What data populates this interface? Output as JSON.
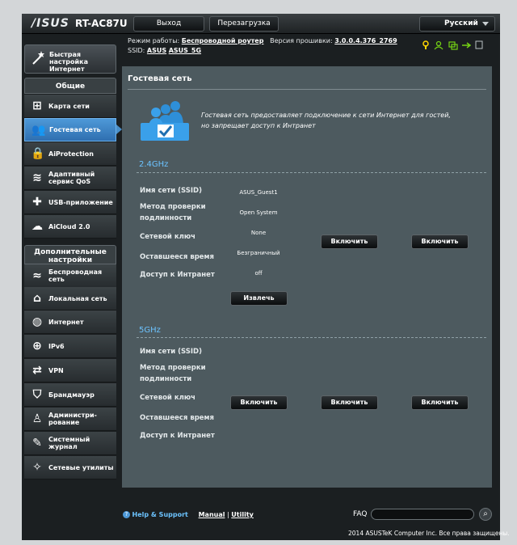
{
  "header": {
    "logo": "/ISUS",
    "model": "RT-AC87U",
    "logout": "Выход",
    "reboot": "Перезагрузка",
    "language": "Русский"
  },
  "info": {
    "mode_label": "Режим работы:",
    "mode_value": "Беспроводной роутер",
    "fw_label": "Версия прошивки:",
    "fw_value": "3.0.0.4.376_2769",
    "ssid_label": "SSID:",
    "ssid1": "ASUS",
    "ssid2": "ASUS_5G"
  },
  "sidebar": {
    "quick": "Быстрая настройка Интернет",
    "general_title": "Общие",
    "general": [
      {
        "label": "Карта сети",
        "icon": "network-map-icon"
      },
      {
        "label": "Гостевая сеть",
        "icon": "guest-network-icon"
      },
      {
        "label": "AiProtection",
        "icon": "lock-icon"
      },
      {
        "label": "Адаптивный сервис QoS",
        "icon": "qos-icon"
      },
      {
        "label": "USB-приложение",
        "icon": "usb-app-icon"
      },
      {
        "label": "AiCloud 2.0",
        "icon": "cloud-icon"
      }
    ],
    "advanced_title": "Дополнительные настройки",
    "advanced": [
      {
        "label": "Беспроводная сеть",
        "icon": "wifi-icon"
      },
      {
        "label": "Локальная сеть",
        "icon": "home-icon"
      },
      {
        "label": "Интернет",
        "icon": "globe-icon"
      },
      {
        "label": "IPv6",
        "icon": "ipv6-icon"
      },
      {
        "label": "VPN",
        "icon": "vpn-icon"
      },
      {
        "label": "Брандмауэр",
        "icon": "firewall-icon"
      },
      {
        "label": "Администри-рование",
        "icon": "admin-icon"
      },
      {
        "label": "Системный журнал",
        "icon": "log-icon"
      },
      {
        "label": "Сетевые утилиты",
        "icon": "tools-icon"
      }
    ]
  },
  "content": {
    "title": "Гостевая сеть",
    "desc1": "Гостевая сеть предоставляет подключение к сети Интернет для гостей,",
    "desc2": "но запрещает доступ к Интранет",
    "band24": "2.4GHz",
    "band5": "5GHz",
    "labels": {
      "ssid": "Имя сети (SSID)",
      "auth1": "Метод проверки",
      "auth2": "подлинности",
      "key": "Сетевой ключ",
      "time": "Оставшееся время",
      "intranet": "Доступ к Интранет"
    },
    "guest1": {
      "ssid": "ASUS_Guest1",
      "auth": "Open System",
      "key": "None",
      "time": "Безграничный",
      "intranet": "off"
    },
    "enable": "Включить",
    "remove": "Извлечь"
  },
  "footer": {
    "help": "Help & Support",
    "manual": "Manual",
    "sep": "|",
    "utility": "Utility",
    "faq": "FAQ",
    "copyright": "2014  ASUSTeK Computer Inc. Все права защищены."
  },
  "colors": {
    "accent": "#4e99d8",
    "band": "#6cc3ff",
    "panel": "#4d5a5f"
  }
}
